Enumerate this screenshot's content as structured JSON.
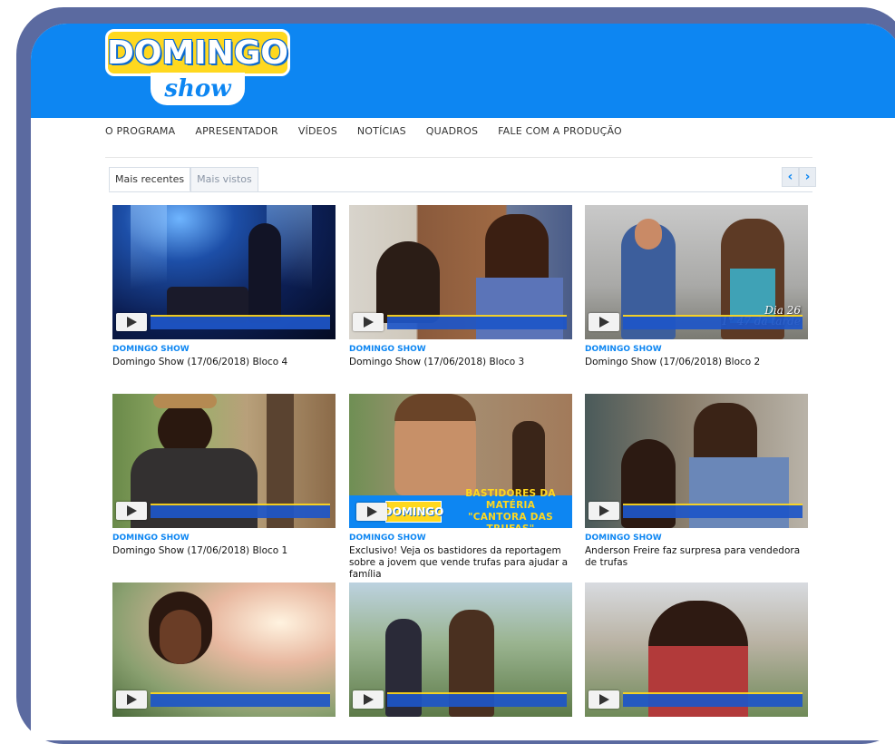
{
  "brand": {
    "logo_main": "DOMINGO",
    "logo_sub": "show"
  },
  "nav": {
    "items": [
      "O PROGRAMA",
      "APRESENTADOR",
      "VÍDEOS",
      "NOTÍCIAS",
      "QUADROS",
      "FALE COM A PRODUÇÃO"
    ]
  },
  "tabs": {
    "recent": "Mais recentes",
    "most_viewed": "Mais vistos",
    "prev": "‹",
    "next": "›"
  },
  "videos": [
    {
      "category": "DOMINGO SHOW",
      "title": "Domingo Show (17/06/2018) Bloco 4"
    },
    {
      "category": "DOMINGO SHOW",
      "title": "Domingo Show (17/06/2018) Bloco 3"
    },
    {
      "category": "DOMINGO SHOW",
      "title": "Domingo Show (17/06/2018) Bloco 2",
      "overlay": "Dia 26\n1° 47 da tarde"
    },
    {
      "category": "DOMINGO SHOW",
      "title": "Domingo Show (17/06/2018) Bloco 1"
    },
    {
      "category": "DOMINGO SHOW",
      "title": "Exclusivo! Veja os bastidores da reportagem sobre a jovem que vende trufas para ajudar a família",
      "banner_logo": "DOMINGO",
      "banner_line1": "BASTIDORES DA MATÉRIA",
      "banner_line2": "\"CANTORA DAS TRUFAS\""
    },
    {
      "category": "DOMINGO SHOW",
      "title": "Anderson Freire faz surpresa para vendedora de trufas"
    },
    {
      "category": "",
      "title": ""
    },
    {
      "category": "",
      "title": ""
    },
    {
      "category": "",
      "title": ""
    }
  ],
  "colors": {
    "header": "#0d86f2",
    "accent": "#0d86f2",
    "logo_yellow": "#ffd81f",
    "frame": "#5b6aa0"
  }
}
